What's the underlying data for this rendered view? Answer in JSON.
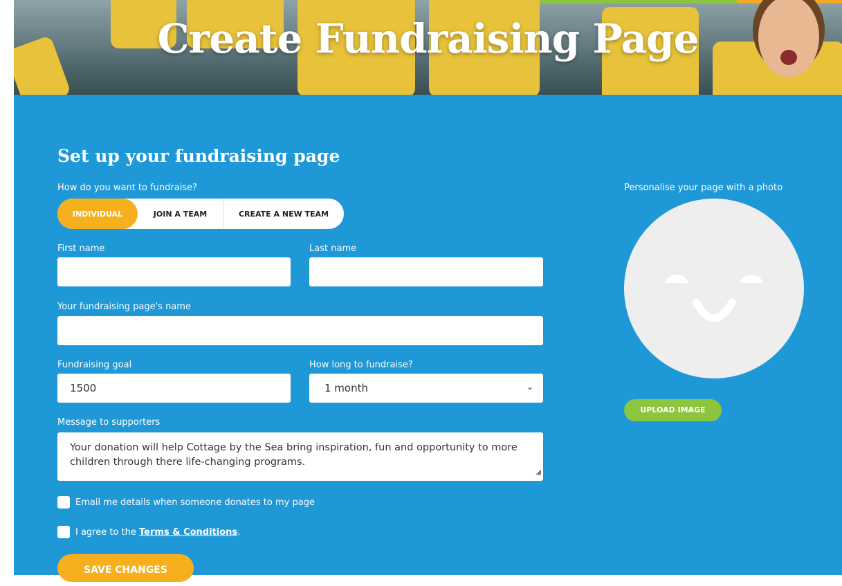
{
  "hero": {
    "title": "Create Fundraising Page"
  },
  "form": {
    "heading": "Set up your fundraising page",
    "mode_question": "How do you want to fundraise?",
    "modes": [
      {
        "label": "INDIVIDUAL",
        "active": true
      },
      {
        "label": "JOIN A TEAM",
        "active": false
      },
      {
        "label": "CREATE A NEW TEAM",
        "active": false
      }
    ],
    "first_name": {
      "label": "First name",
      "value": ""
    },
    "last_name": {
      "label": "Last name",
      "value": ""
    },
    "page_name": {
      "label": "Your fundraising page's name",
      "value": ""
    },
    "goal": {
      "label": "Fundraising goal",
      "value": "1500"
    },
    "duration": {
      "label": "How long to fundraise?",
      "value": "1 month"
    },
    "message": {
      "label": "Message to supporters",
      "value": "Your donation will help Cottage by the Sea bring inspiration, fun and opportunity to more children through there life-changing programs."
    },
    "email_opt": {
      "label": "Email me details when someone donates to my page",
      "checked": false
    },
    "terms": {
      "prefix": "I agree to the",
      "link": "Terms & Conditions",
      "suffix": ".",
      "checked": false
    },
    "save_label": "SAVE CHANGES"
  },
  "photo": {
    "label": "Personalise your page with a photo",
    "upload_label": "UPLOAD IMAGE"
  },
  "colors": {
    "panel": "#1e98d6",
    "accent_orange": "#f7b01d",
    "accent_green": "#8cc63f"
  }
}
